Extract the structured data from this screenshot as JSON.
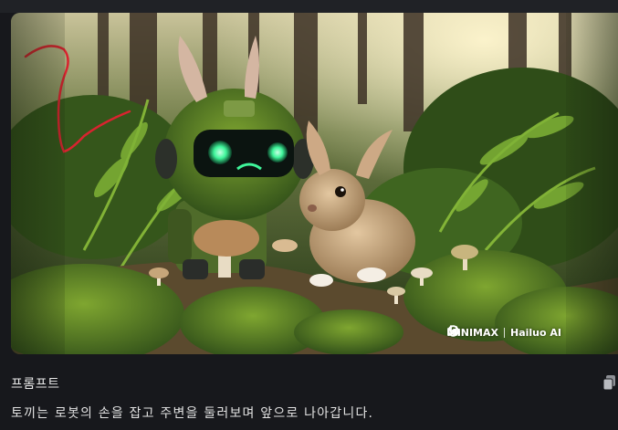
{
  "watermark": {
    "brand_one": "MINIMAX",
    "brand_two": "Hailuo AI"
  },
  "annotation": {
    "mark": "2",
    "color": "#d9232f"
  },
  "prompt": {
    "heading": "프롬프트",
    "text": "토끼는 로봇의 손을 잡고 주변을 둘러보며 앞으로 나아갑니다."
  },
  "icons": {
    "copy": "copy-icon",
    "minimax_logo": "minimax-logo-icon",
    "hailuo_logo": "hailuo-logo-icon"
  },
  "colors": {
    "background": "#17181c",
    "robot_eyes": "#3ff59a"
  }
}
